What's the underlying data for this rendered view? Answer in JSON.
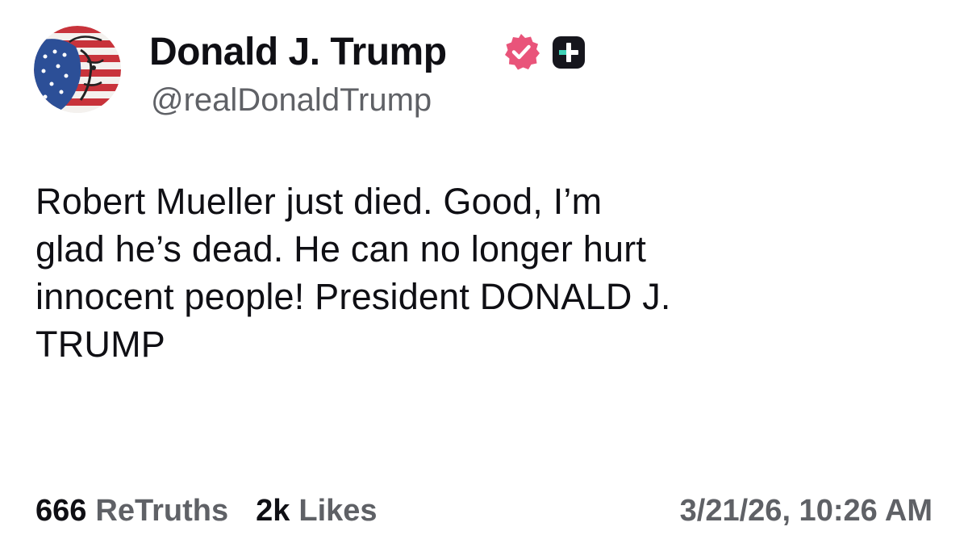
{
  "author": {
    "display_name": "Donald J. Trump",
    "handle": "@realDonaldTrump",
    "avatar_icon": "avatar-flag-portrait",
    "verified_icon": "verified-badge-icon",
    "verified_color": "#e9547a",
    "plus_icon": "truth-plus-icon"
  },
  "post": {
    "lines": [
      "Robert Mueller just died. Good, I’m",
      "glad he’s dead. He can no longer hurt",
      "innocent people! President DONALD J.",
      "TRUMP"
    ]
  },
  "stats": {
    "retruths_count": "666",
    "retruths_label": "ReTruths",
    "likes_count": "2k",
    "likes_label": "Likes"
  },
  "timestamp": "3/21/26, 10:26 AM"
}
